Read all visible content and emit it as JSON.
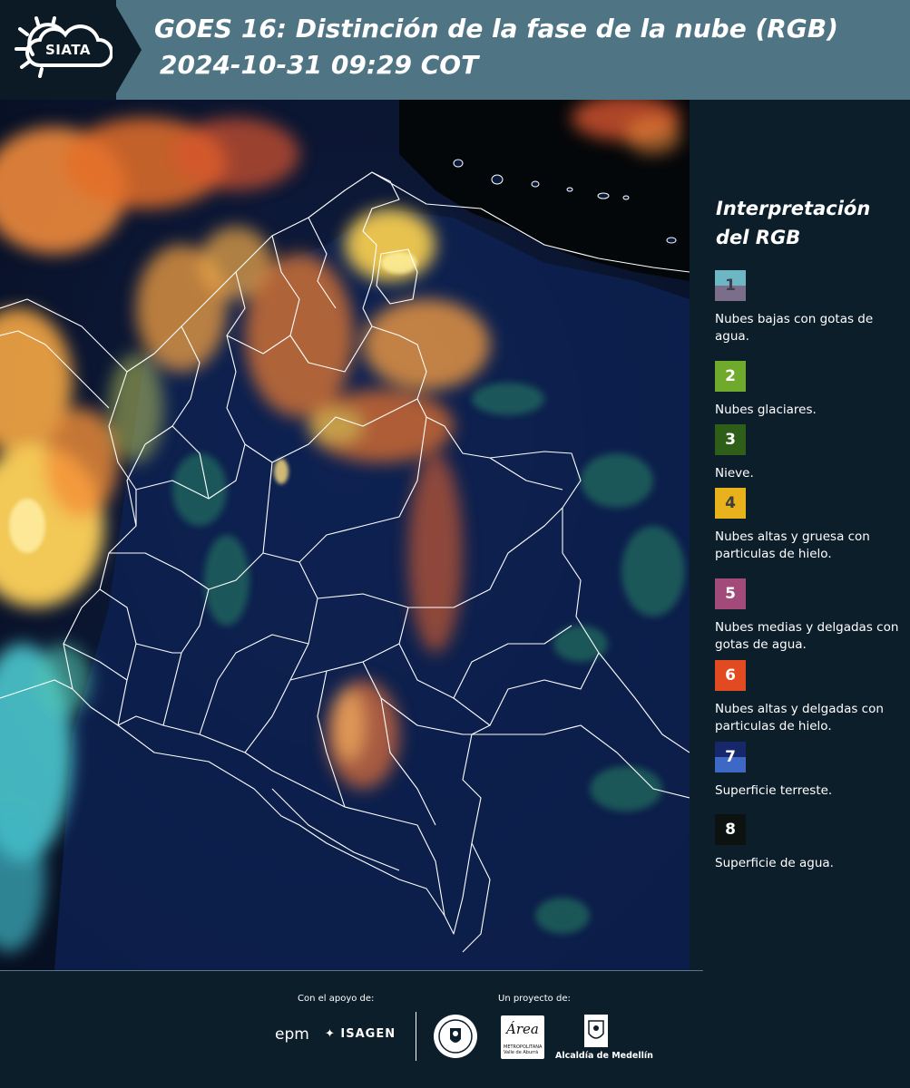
{
  "header": {
    "logo_text": "SIATA",
    "title_line1": "GOES 16: Distinción de la fase de la nube (RGB)",
    "title_line2": "2024-10-31 09:29 COT"
  },
  "legend": {
    "title": "Interpretación del RGB",
    "items": [
      {
        "number": "1",
        "label": "Nubes bajas con gotas de agua.",
        "color_top": "#6cb7c3",
        "color_bottom": "#7a6e8a",
        "num_color": "#3d3d4d"
      },
      {
        "number": "2",
        "label": "Nubes glaciares.",
        "color_top": "#6faa2c",
        "color_bottom": "#6faa2c",
        "num_color": "#ffffff"
      },
      {
        "number": "3",
        "label": "Nieve.",
        "color_top": "#2f5e18",
        "color_bottom": "#2f5e18",
        "num_color": "#ffffff"
      },
      {
        "number": "4",
        "label": "Nubes altas y gruesa con particulas de hielo.",
        "color_top": "#e8b21c",
        "color_bottom": "#e8b21c",
        "num_color": "#3d3d3d"
      },
      {
        "number": "5",
        "label": "Nubes medias y delgadas con gotas de agua.",
        "color_top": "#a24a7a",
        "color_bottom": "#a24a7a",
        "num_color": "#ffffff"
      },
      {
        "number": "6",
        "label": "Nubes altas y delgadas con particulas de hielo.",
        "color_top": "#e24b22",
        "color_bottom": "#e24b22",
        "num_color": "#ffffff"
      },
      {
        "number": "7",
        "label": "Superficie terreste.",
        "color_top": "#16286a",
        "color_bottom": "#3e68c6",
        "num_color": "#ffffff"
      },
      {
        "number": "8",
        "label": "Superficie de agua.",
        "color_top": "#0b1210",
        "color_bottom": "#0b1210",
        "num_color": "#ffffff"
      }
    ]
  },
  "footer": {
    "support_label": "Con el apoyo de:",
    "project_label": "Un proyecto de:",
    "epm": "epm",
    "isagen": "ISAGEN",
    "area_script": "Área",
    "area_small": "METROPOLITANA Valle de Aburrá",
    "alcaldia": "Alcaldía de Medellín"
  }
}
